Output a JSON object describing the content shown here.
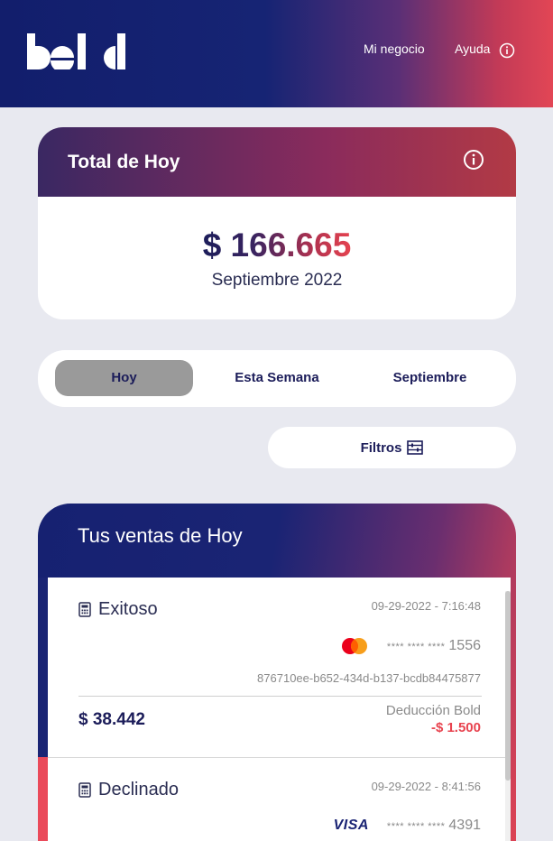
{
  "header": {
    "logo_text": "bold",
    "nav": {
      "negocio": "Mi negocio",
      "ayuda": "Ayuda"
    },
    "icons": {
      "help": "info-circle-icon"
    }
  },
  "total_card": {
    "title": "Total de Hoy",
    "amount": "$ 166.665",
    "period": "Septiembre 2022",
    "info_icon": "info-circle-icon"
  },
  "tabs": {
    "today": "Hoy",
    "week": "Esta Semana",
    "month": "Septiembre",
    "selected": "Hoy"
  },
  "filters": {
    "label": "Filtros",
    "icon": "filter-icon"
  },
  "sales": {
    "title": "Tus ventas de Hoy",
    "items": [
      {
        "status": "Exitoso",
        "timestamp": "09-29-2022 - 7:16:48",
        "card_brand": "mastercard",
        "masked": "**** **** ****",
        "last4": "1556",
        "tx_id": "876710ee-b652-434d-b137-bcdb84475877",
        "amount": "$ 38.442",
        "fee_label": "Deducción Bold",
        "fee_value": "-$ 1.500",
        "accent_color": "#1a2474"
      },
      {
        "status": "Declinado",
        "timestamp": "09-29-2022 - 8:41:56",
        "card_brand": "VISA",
        "masked": "**** **** ****",
        "last4": "4391",
        "accent_color": "#ea4a5a"
      }
    ]
  },
  "colors": {
    "brand_navy": "#121e6c",
    "brand_red": "#e24655",
    "negative": "#e8434f"
  }
}
